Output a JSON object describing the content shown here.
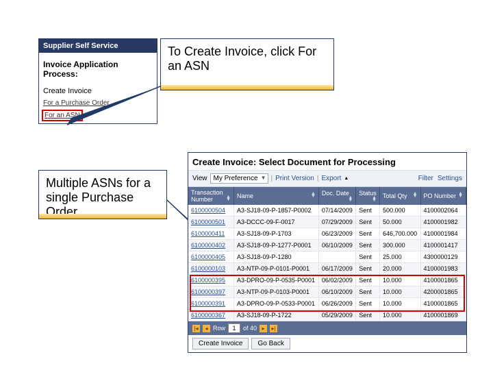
{
  "sidebar": {
    "header": "Supplier Self Service",
    "subheader": "Invoice Application Process:",
    "create_label": "Create Invoice",
    "links": {
      "po": "For a Purchase Order",
      "asn": "For an ASN"
    }
  },
  "callout1": "To Create Invoice, click For an ASN",
  "callout2": "Multiple ASNs for a single Purchase Order",
  "grid": {
    "title": "Create Invoice: Select Document for Processing",
    "view_label": "View",
    "view_select": "My Preference",
    "print": "Print Version",
    "export": "Export",
    "filter": "Filter",
    "settings": "Settings",
    "columns": {
      "tn": "Transaction Number",
      "nm": "Name",
      "dt": "Doc. Date",
      "st": "Status",
      "qt": "Total Qty",
      "po": "PO Number"
    },
    "rows": [
      {
        "tn": "6100000504",
        "nm": "A3-SJ18-09-P-1857-P0002",
        "dt": "07/14/2009",
        "st": "Sent",
        "qt": "500.000",
        "po": "4100002064"
      },
      {
        "tn": "6100000501",
        "nm": "A3-DCCC-09-F-0017",
        "dt": "07/29/2009",
        "st": "Sent",
        "qt": "50.000",
        "po": "4100001982"
      },
      {
        "tn": "6100000411",
        "nm": "A3-SJ18-09-P-1703",
        "dt": "06/23/2009",
        "st": "Sent",
        "qt": "646,700.000",
        "po": "4100001984"
      },
      {
        "tn": "6100000402",
        "nm": "A3-SJ18-09-P-1277-P0001",
        "dt": "06/10/2009",
        "st": "Sent",
        "qt": "300.000",
        "po": "4100001417"
      },
      {
        "tn": "6100000405",
        "nm": "A3-SJ18-09-P-1280",
        "dt": "",
        "st": "Sent",
        "qt": "25.000",
        "po": "4300000129"
      },
      {
        "tn": "6100000103",
        "nm": "A3-NTP-09-P-0101-P0001",
        "dt": "06/17/2009",
        "st": "Sent",
        "qt": "20.000",
        "po": "4100001983"
      },
      {
        "tn": "6100000395",
        "nm": "A3-DPRO-09-P-0535-P0001",
        "dt": "06/02/2009",
        "st": "Sent",
        "qt": "10.000",
        "po": "4100001865"
      },
      {
        "tn": "6100000397",
        "nm": "A3-NTP-09-P-0103-P0001",
        "dt": "06/10/2009",
        "st": "Sent",
        "qt": "10.000",
        "po": "4200001865"
      },
      {
        "tn": "6100000391",
        "nm": "A3-DPRO-09-P-0533-P0001",
        "dt": "06/26/2009",
        "st": "Sent",
        "qt": "10.000",
        "po": "4100001865"
      },
      {
        "tn": "6100000367",
        "nm": "A3-SJ18-09-P-1722",
        "dt": "05/29/2009",
        "st": "Sent",
        "qt": "10.000",
        "po": "4100001869"
      }
    ],
    "pager": {
      "row_label": "Row",
      "current": "1",
      "total": "of 40"
    },
    "actions": {
      "create": "Create Invoice",
      "back": "Go Back"
    }
  }
}
